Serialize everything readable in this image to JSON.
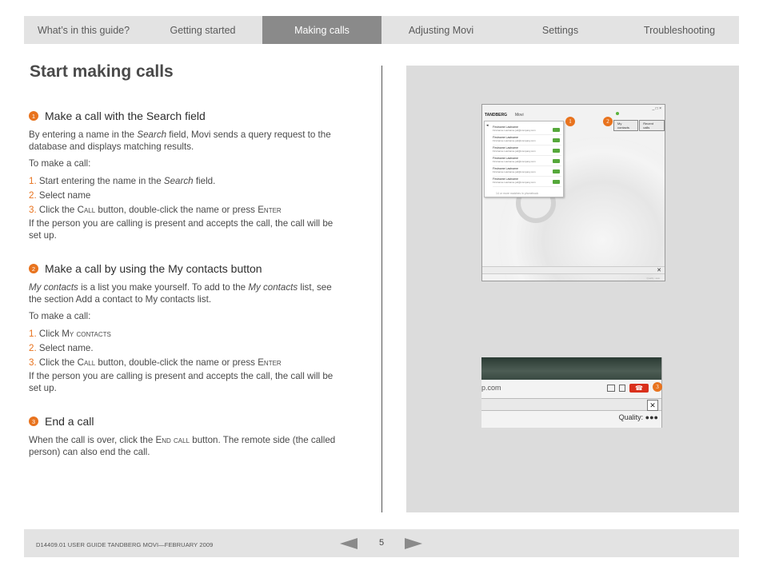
{
  "nav": {
    "tabs": [
      {
        "label": "What’s in this guide?"
      },
      {
        "label": "Getting started"
      },
      {
        "label": "Making calls"
      },
      {
        "label": "Adjusting Movi"
      },
      {
        "label": "Settings"
      },
      {
        "label": "Troubleshooting"
      }
    ],
    "active_index": 2
  },
  "page_title": "Start making calls",
  "sections": [
    {
      "number": "1",
      "heading": "Make a call with the Search field",
      "intro_a": "By entering a name in the ",
      "intro_em": "Search",
      "intro_b": " field, Movi sends a query request to the database and displays matching results.",
      "to_make": "To make a call:",
      "steps": [
        {
          "n": "1.",
          "a": " Start entering the name in the ",
          "em": "Search",
          "b": " field."
        },
        {
          "n": "2.",
          "a": " Select name"
        },
        {
          "n": "3.",
          "a": " Click the ",
          "sc": "Call",
          "b": " button, double-click the name or press ",
          "sc2": "Enter"
        }
      ],
      "outro": "If the person you are calling is present and accepts the call, the call will be set up."
    },
    {
      "number": "2",
      "heading": "Make a call by using the My contacts button",
      "intro_em": "My contacts",
      "intro_a": " is a list you make yourself. To add to the ",
      "intro_em2": "My contacts",
      "intro_b": " list, see the section Add a contact to My contacts list.",
      "to_make": "To make a call:",
      "steps": [
        {
          "n": "1.",
          "a": " Click ",
          "sc": "My contacts"
        },
        {
          "n": "2.",
          "a": " Select name."
        },
        {
          "n": "3.",
          "a": " Click the ",
          "sc": "Call",
          "b": " button, double-click the name or press ",
          "sc2": "Enter"
        }
      ],
      "outro": "If the person you are calling is present and accepts the call, the call will be set up."
    },
    {
      "number": "3",
      "heading": "End a call",
      "intro_a": "When the call is over, click the ",
      "intro_sc": "End call",
      "intro_b": " button. The remote side (the called person) can also end the call."
    }
  ],
  "screenshot1": {
    "logo": "TANDBERG",
    "app_name": "Movi",
    "window_buttons": "_ □ ×",
    "search_icon": "magnifier-icon",
    "results": [
      {
        "name": "Firstname Lastname",
        "sub": "Firstname.Lastname.jod@company.com"
      },
      {
        "name": "Firstname Lastname",
        "sub": "Firstname.Lastname.jod@company.com"
      },
      {
        "name": "Firstname Lastname",
        "sub": "Firstname.Lastname.jod@company.com"
      },
      {
        "name": "Firstname Lastname",
        "sub": "Firstname.Lastname.jod@company.com"
      },
      {
        "name": "Firstname Lastname",
        "sub": "Firstname.Lastname.jod@company.com"
      },
      {
        "name": "Firstname Lastname",
        "sub": "Firstname.Lastname.jod@company.com"
      }
    ],
    "more_text": "14 or more matches in phonebook",
    "tabs": [
      "My contacts",
      "Recent calls"
    ],
    "tools_glyph": "✕",
    "footer_text": "Quality: ●●●"
  },
  "screenshot2": {
    "url_text": "p.com",
    "hangup_glyph": "☎",
    "tools_glyph": "✕",
    "quality_text": "Quality: ●●●"
  },
  "callouts": [
    "1",
    "2",
    "3"
  ],
  "footer": {
    "doc_id": "D14409.01 USER GUIDE TANDBERG MOVI—FEBRUARY 2009",
    "page_number": "5"
  },
  "colors": {
    "accent": "#e8731e",
    "nav_bg": "#e3e3e3",
    "nav_active": "#8a8a8a",
    "panel_bg": "#dcdcdc",
    "call_green": "#55a83a",
    "hangup_red": "#d9301c"
  }
}
